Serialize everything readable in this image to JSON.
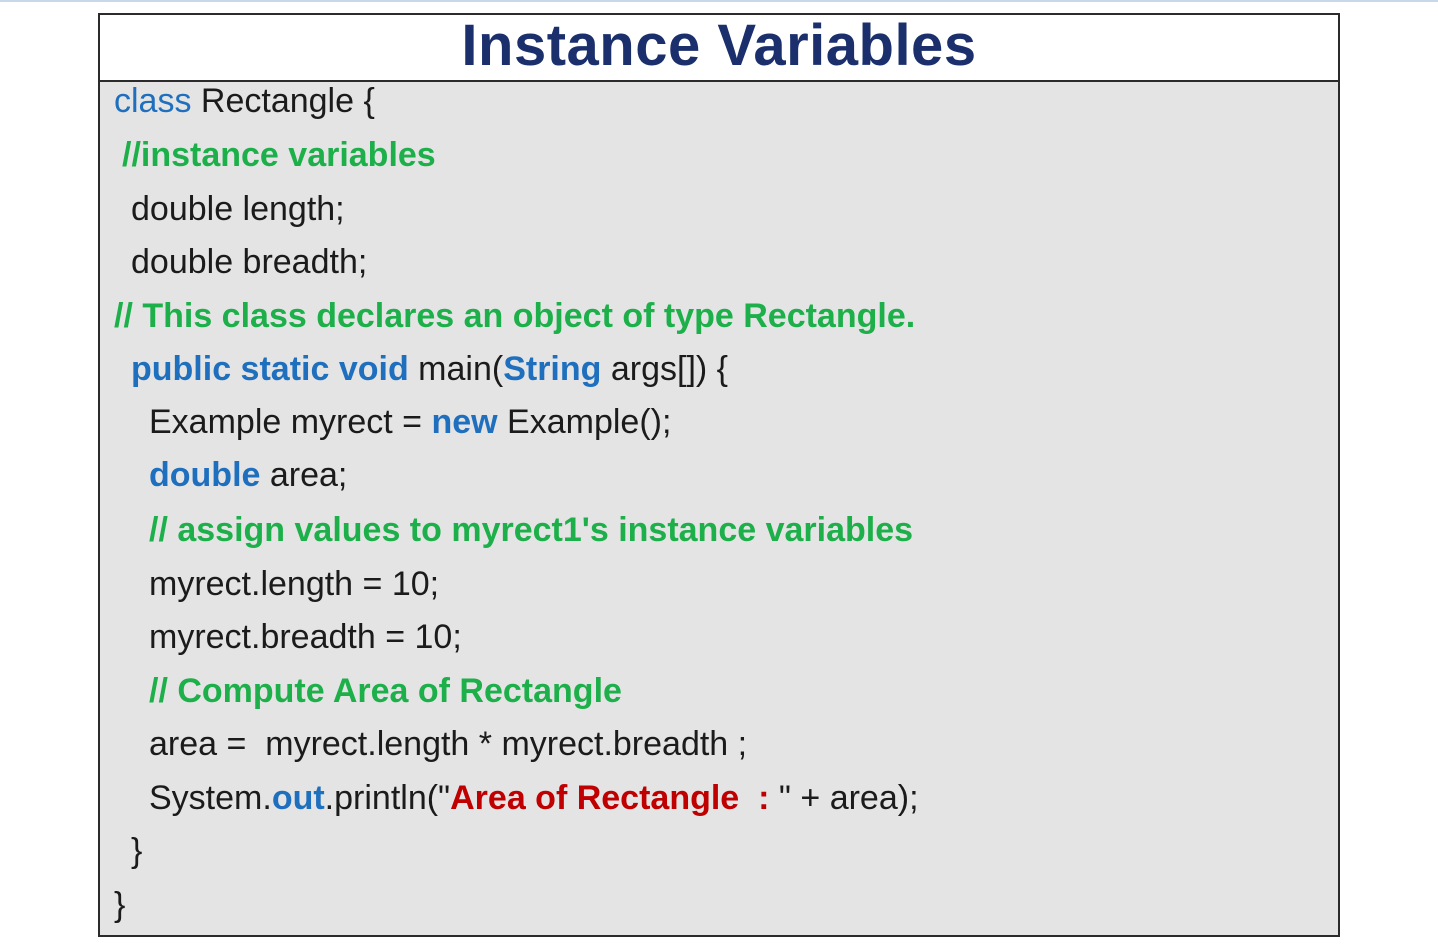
{
  "title": "Instance Variables",
  "colors": {
    "keyword": "#1f6fbf",
    "comment": "#1db04a",
    "string": "#c00000",
    "text": "#1b1b1b",
    "title": "#1a2f6b",
    "panel_background": "#e4e4e4"
  },
  "code": {
    "l1": {
      "kw": "class",
      "text": " Rectangle {"
    },
    "l2": {
      "comment": "//instance variables"
    },
    "l3": {
      "text": "double length;"
    },
    "l4": {
      "text": "double breadth;"
    },
    "l5": {
      "comment": "// This class declares an object of type Rectangle."
    },
    "l6": {
      "kw": "public static void",
      "t1": " main(",
      "kw2": "String",
      "t2": " args[]) {"
    },
    "l7": {
      "t1": "Example myrect = ",
      "kw": "new",
      "t2": " Example();"
    },
    "l8": {
      "kw": "double",
      "text": " area;"
    },
    "l9": {
      "comment": "// assign values to myrect1's instance variables"
    },
    "l10": {
      "text": "myrect.length = 10;"
    },
    "l11": {
      "text": "myrect.breadth = 10;"
    },
    "l12": {
      "comment": "// Compute Area of Rectangle"
    },
    "l13": {
      "text": "area =  myrect.length * myrect.breadth ;"
    },
    "l14": {
      "t1": "System.",
      "kw": "out",
      "t2": ".println(\"",
      "str": "Area of Rectangle  : ",
      "t3": "\" + area);"
    },
    "l15": {
      "text": "}"
    },
    "l16": {
      "text": "}"
    }
  }
}
